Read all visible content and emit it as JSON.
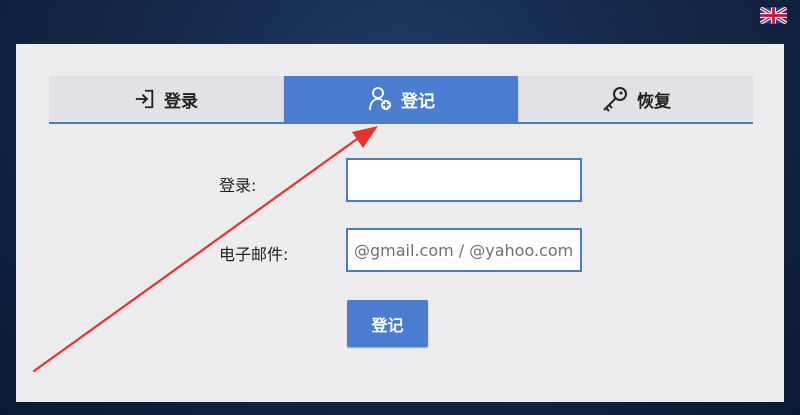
{
  "header": {
    "language_flag_icon": "uk-flag-icon"
  },
  "tabs": [
    {
      "label": "登录",
      "icon": "login-icon",
      "active": false
    },
    {
      "label": "登记",
      "icon": "add-user-icon",
      "active": true
    },
    {
      "label": "恢复",
      "icon": "key-icon",
      "active": false
    }
  ],
  "form": {
    "login_label": "登录:",
    "login_value": "",
    "email_label": "电子邮件:",
    "email_placeholder": "@gmail.com / @yahoo.com",
    "email_value": "",
    "submit_label": "登记"
  },
  "colors": {
    "accent": "#4a7cd0",
    "annotation_arrow": "#e8322b",
    "panel_bg": "#ececef",
    "page_bg": "#142848"
  },
  "annotation": {
    "type": "arrow",
    "points_to": "tab-register"
  }
}
